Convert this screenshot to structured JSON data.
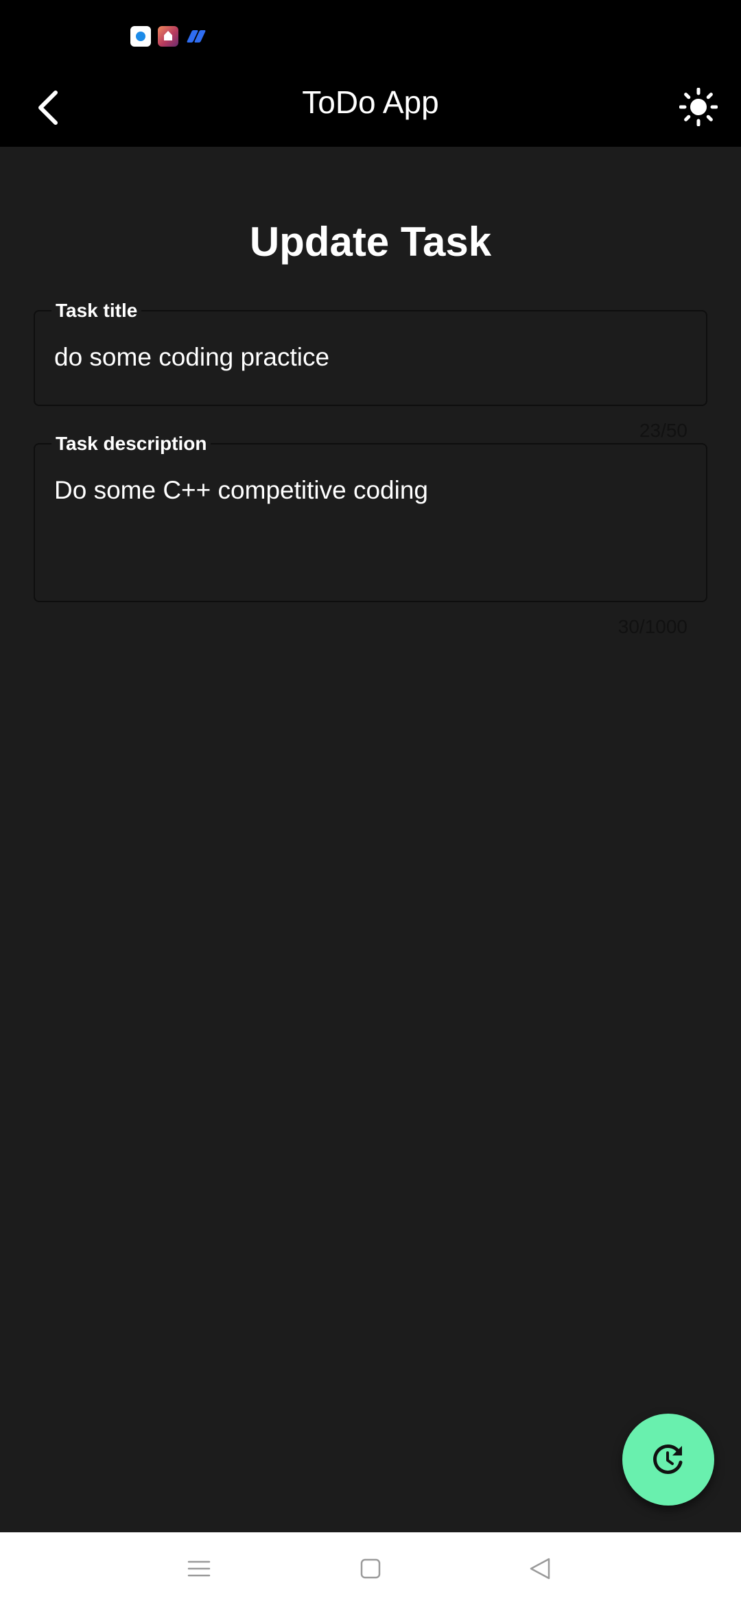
{
  "status_bar": {
    "icons": [
      "app-notification-icon",
      "app-notification-icon",
      "app-notification-icon"
    ]
  },
  "app_bar": {
    "title": "ToDo App",
    "back_icon": "chevron-left-icon",
    "theme_icon": "sun-icon"
  },
  "form": {
    "heading": "Update Task",
    "title_field": {
      "label": "Task title",
      "value": "do some coding practice",
      "counter": "23/50"
    },
    "description_field": {
      "label": "Task description",
      "value": "Do some C++ competitive coding",
      "counter": "30/1000"
    }
  },
  "fab": {
    "icon": "update-icon",
    "color": "#69f0ae"
  },
  "nav_bar": {
    "icons": [
      "menu-icon",
      "home-icon",
      "back-icon"
    ]
  },
  "colors": {
    "app_bar": "#000000",
    "background": "#1c1c1c",
    "accent": "#69f0ae"
  }
}
